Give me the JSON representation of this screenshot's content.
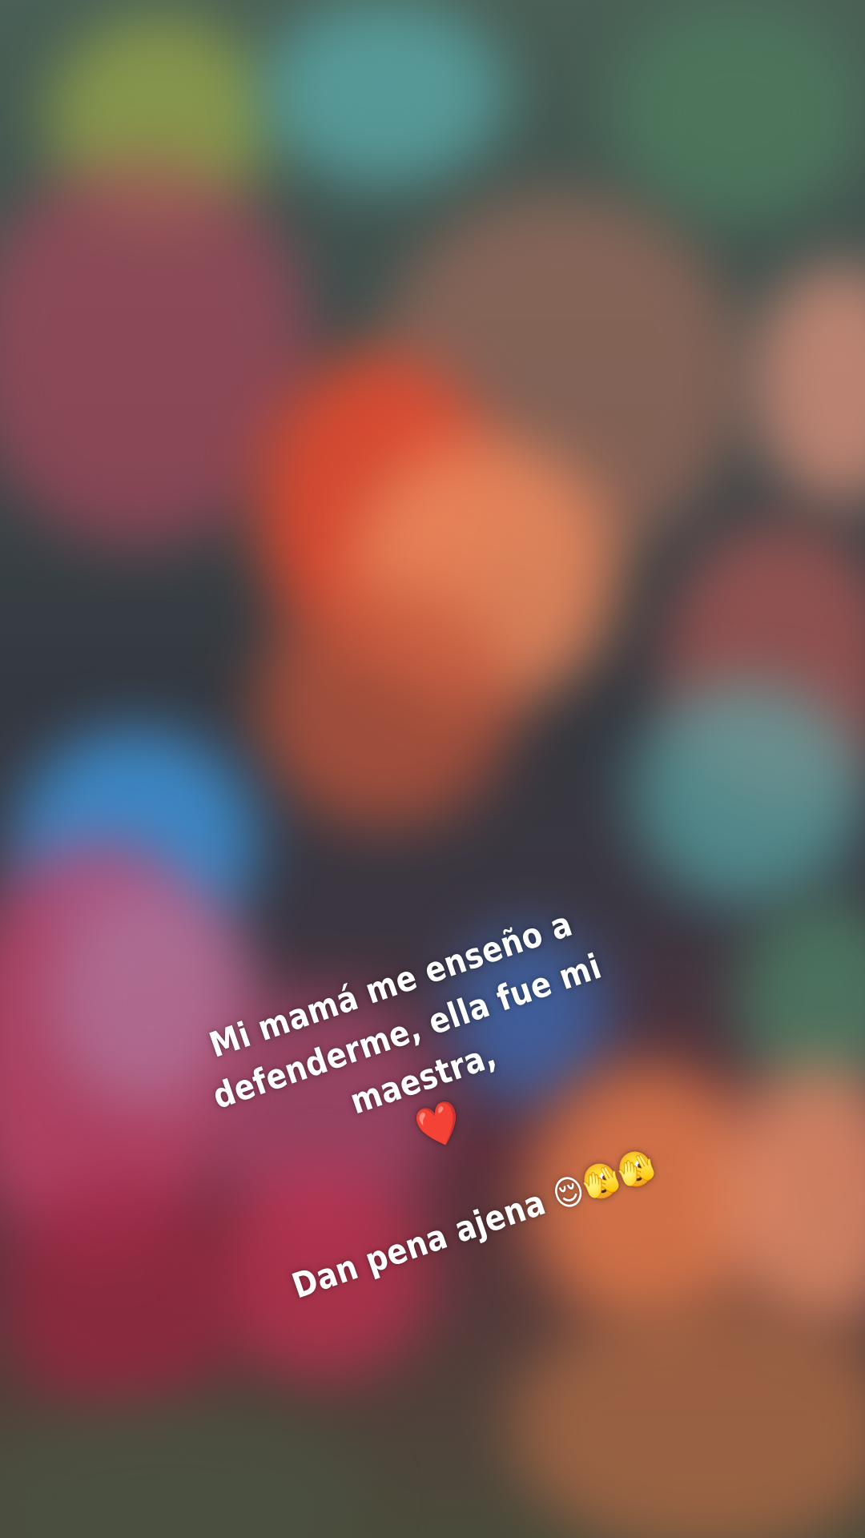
{
  "story": {
    "line1": "Mi mamá me enseño a",
    "line2": "defenderme, ella fue mi maestra,",
    "line3": "❤️",
    "line4": "Dan pena ajena 😌🫣🫣"
  },
  "background": {
    "style": "blurred bokeh lights",
    "colors": [
      "#e34a2f",
      "#e8875c",
      "#3d8fd1",
      "#c2456b",
      "#5aa8a8",
      "#9aa84a",
      "#d9907a"
    ]
  }
}
